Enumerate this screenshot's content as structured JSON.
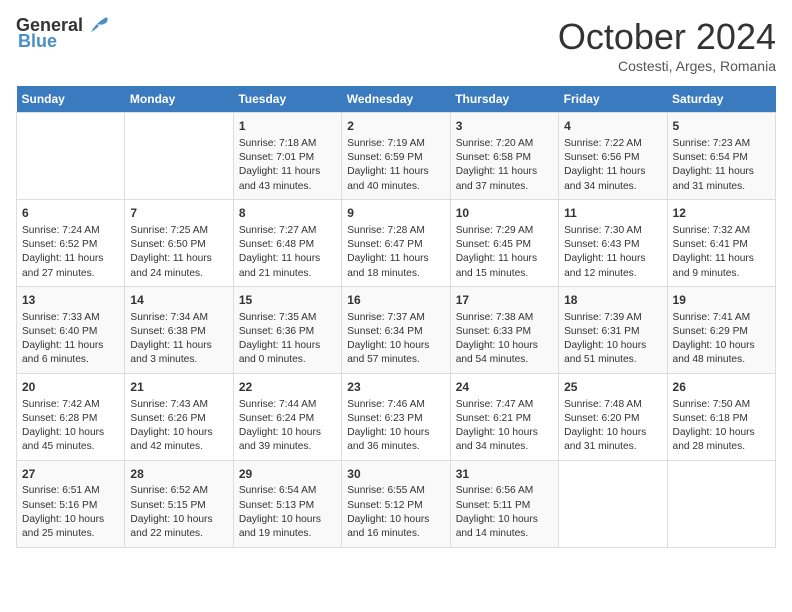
{
  "header": {
    "logo_general": "General",
    "logo_blue": "Blue",
    "month": "October 2024",
    "location": "Costesti, Arges, Romania"
  },
  "calendar": {
    "days_of_week": [
      "Sunday",
      "Monday",
      "Tuesday",
      "Wednesday",
      "Thursday",
      "Friday",
      "Saturday"
    ],
    "weeks": [
      [
        {
          "day": "",
          "content": ""
        },
        {
          "day": "",
          "content": ""
        },
        {
          "day": "1",
          "content": "Sunrise: 7:18 AM\nSunset: 7:01 PM\nDaylight: 11 hours and 43 minutes."
        },
        {
          "day": "2",
          "content": "Sunrise: 7:19 AM\nSunset: 6:59 PM\nDaylight: 11 hours and 40 minutes."
        },
        {
          "day": "3",
          "content": "Sunrise: 7:20 AM\nSunset: 6:58 PM\nDaylight: 11 hours and 37 minutes."
        },
        {
          "day": "4",
          "content": "Sunrise: 7:22 AM\nSunset: 6:56 PM\nDaylight: 11 hours and 34 minutes."
        },
        {
          "day": "5",
          "content": "Sunrise: 7:23 AM\nSunset: 6:54 PM\nDaylight: 11 hours and 31 minutes."
        }
      ],
      [
        {
          "day": "6",
          "content": "Sunrise: 7:24 AM\nSunset: 6:52 PM\nDaylight: 11 hours and 27 minutes."
        },
        {
          "day": "7",
          "content": "Sunrise: 7:25 AM\nSunset: 6:50 PM\nDaylight: 11 hours and 24 minutes."
        },
        {
          "day": "8",
          "content": "Sunrise: 7:27 AM\nSunset: 6:48 PM\nDaylight: 11 hours and 21 minutes."
        },
        {
          "day": "9",
          "content": "Sunrise: 7:28 AM\nSunset: 6:47 PM\nDaylight: 11 hours and 18 minutes."
        },
        {
          "day": "10",
          "content": "Sunrise: 7:29 AM\nSunset: 6:45 PM\nDaylight: 11 hours and 15 minutes."
        },
        {
          "day": "11",
          "content": "Sunrise: 7:30 AM\nSunset: 6:43 PM\nDaylight: 11 hours and 12 minutes."
        },
        {
          "day": "12",
          "content": "Sunrise: 7:32 AM\nSunset: 6:41 PM\nDaylight: 11 hours and 9 minutes."
        }
      ],
      [
        {
          "day": "13",
          "content": "Sunrise: 7:33 AM\nSunset: 6:40 PM\nDaylight: 11 hours and 6 minutes."
        },
        {
          "day": "14",
          "content": "Sunrise: 7:34 AM\nSunset: 6:38 PM\nDaylight: 11 hours and 3 minutes."
        },
        {
          "day": "15",
          "content": "Sunrise: 7:35 AM\nSunset: 6:36 PM\nDaylight: 11 hours and 0 minutes."
        },
        {
          "day": "16",
          "content": "Sunrise: 7:37 AM\nSunset: 6:34 PM\nDaylight: 10 hours and 57 minutes."
        },
        {
          "day": "17",
          "content": "Sunrise: 7:38 AM\nSunset: 6:33 PM\nDaylight: 10 hours and 54 minutes."
        },
        {
          "day": "18",
          "content": "Sunrise: 7:39 AM\nSunset: 6:31 PM\nDaylight: 10 hours and 51 minutes."
        },
        {
          "day": "19",
          "content": "Sunrise: 7:41 AM\nSunset: 6:29 PM\nDaylight: 10 hours and 48 minutes."
        }
      ],
      [
        {
          "day": "20",
          "content": "Sunrise: 7:42 AM\nSunset: 6:28 PM\nDaylight: 10 hours and 45 minutes."
        },
        {
          "day": "21",
          "content": "Sunrise: 7:43 AM\nSunset: 6:26 PM\nDaylight: 10 hours and 42 minutes."
        },
        {
          "day": "22",
          "content": "Sunrise: 7:44 AM\nSunset: 6:24 PM\nDaylight: 10 hours and 39 minutes."
        },
        {
          "day": "23",
          "content": "Sunrise: 7:46 AM\nSunset: 6:23 PM\nDaylight: 10 hours and 36 minutes."
        },
        {
          "day": "24",
          "content": "Sunrise: 7:47 AM\nSunset: 6:21 PM\nDaylight: 10 hours and 34 minutes."
        },
        {
          "day": "25",
          "content": "Sunrise: 7:48 AM\nSunset: 6:20 PM\nDaylight: 10 hours and 31 minutes."
        },
        {
          "day": "26",
          "content": "Sunrise: 7:50 AM\nSunset: 6:18 PM\nDaylight: 10 hours and 28 minutes."
        }
      ],
      [
        {
          "day": "27",
          "content": "Sunrise: 6:51 AM\nSunset: 5:16 PM\nDaylight: 10 hours and 25 minutes."
        },
        {
          "day": "28",
          "content": "Sunrise: 6:52 AM\nSunset: 5:15 PM\nDaylight: 10 hours and 22 minutes."
        },
        {
          "day": "29",
          "content": "Sunrise: 6:54 AM\nSunset: 5:13 PM\nDaylight: 10 hours and 19 minutes."
        },
        {
          "day": "30",
          "content": "Sunrise: 6:55 AM\nSunset: 5:12 PM\nDaylight: 10 hours and 16 minutes."
        },
        {
          "day": "31",
          "content": "Sunrise: 6:56 AM\nSunset: 5:11 PM\nDaylight: 10 hours and 14 minutes."
        },
        {
          "day": "",
          "content": ""
        },
        {
          "day": "",
          "content": ""
        }
      ]
    ]
  }
}
